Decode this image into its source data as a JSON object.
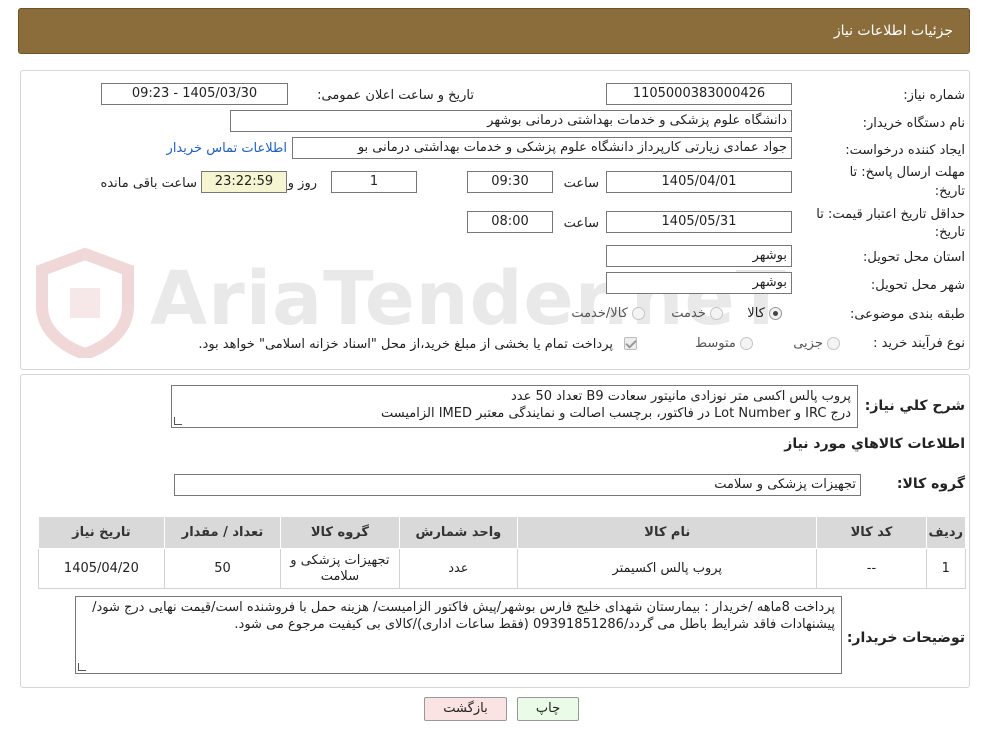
{
  "header": {
    "title": "جزئیات اطلاعات نیاز"
  },
  "need": {
    "number_label": "شماره نیاز:",
    "number": "1105000383000426",
    "announce_label": "تاریخ و ساعت اعلان عمومی:",
    "announce_value": "1405/03/30 - 09:23",
    "buyer_org_label": "نام دستگاه خریدار:",
    "buyer_org": "دانشگاه علوم پزشکی و خدمات بهداشتی درمانی بوشهر",
    "creator_label": "ایجاد کننده درخواست:",
    "creator": "جواد عمادی زیارتی کارپرداز دانشگاه علوم پزشکی و خدمات بهداشتی درمانی بو",
    "contact_link": "اطلاعات تماس خریدار",
    "deadline_label_1": "مهلت ارسال پاسخ: تا",
    "deadline_label_2": "تاریخ:",
    "deadline_date": "1405/04/01",
    "time_label": "ساعت",
    "deadline_time": "09:30",
    "days_value": "1",
    "days_label": "روز و",
    "remaining_value": "23:22:59",
    "remaining_label": "ساعت باقی مانده",
    "validity_label_1": "حداقل تاریخ اعتبار قیمت: تا",
    "validity_label_2": "تاریخ:",
    "validity_date": "1405/05/31",
    "validity_time": "08:00",
    "province_label": "استان محل تحویل:",
    "province": "بوشهر",
    "city_label": "شهر محل تحویل:",
    "city": "بوشهر",
    "category_label": "طبقه بندی موضوعی:",
    "category_options": [
      "کالا",
      "خدمت",
      "کالا/خدمت"
    ],
    "process_label": "نوع فرآیند خرید :",
    "process_options": [
      "جزیی",
      "متوسط"
    ],
    "payment_note": "پرداخت تمام یا بخشی از مبلغ خرید،از محل \"اسناد خزانه اسلامی\" خواهد بود."
  },
  "summary": {
    "label": "شرح کلي نياز:",
    "line1": "پروب پالس اکسی متر نوزادی مانیتور سعادت B9 تعداد 50 عدد",
    "line2": "درج IRC و Lot Number در فاکتور، برچسب اصالت و نمایندگی معتبر IMED الزامیست"
  },
  "goods": {
    "section_title": "اطلاعات کالاهاي مورد نياز",
    "group_label": "گروه کالا:",
    "group_value": "تجهیزات پزشکی و سلامت"
  },
  "table": {
    "headers": [
      "ردیف",
      "کد کالا",
      "نام کالا",
      "واحد شمارش",
      "گروه کالا",
      "تعداد / مقدار",
      "تاریخ نیاز"
    ],
    "rows": [
      [
        "1",
        "--",
        "پروب پالس اکسیمتر",
        "عدد",
        "تجهیزات پزشکی و سلامت",
        "50",
        "1405/04/20"
      ]
    ]
  },
  "buyer_notes": {
    "label": "توضیحات خریدار:",
    "text": "پرداخت 8ماهه /خریدار : بیمارستان شهدای خلیج فارس بوشهر/پیش فاکتور الزامیست/ هزینه حمل با فروشنده است/قیمت نهایی درج شود/پیشنهادات فاقد شرایط باطل می گردد/09391851286 (فقط ساعات اداری)/کالای بی کیفیت مرجوع می شود."
  },
  "buttons": {
    "print": "چاپ",
    "back": "بازگشت"
  },
  "watermark": {
    "text": "AriaTender.neT"
  },
  "colors": {
    "header_bg": "#8a6d3b",
    "link": "#1f5fbf",
    "remaining_bg": "#f6f5d2"
  }
}
